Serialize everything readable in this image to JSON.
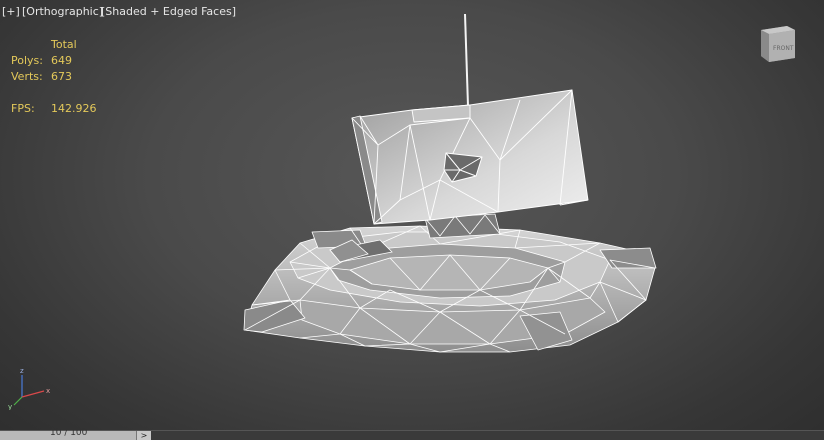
{
  "viewport": {
    "menu_plus": "[+]",
    "view_label": "[Orthographic]",
    "shading_label": "[Shaded + Edged Faces]"
  },
  "stats": {
    "header": "Total",
    "polys_label": "Polys:",
    "polys_value": "649",
    "verts_label": "Verts:",
    "verts_value": "673",
    "fps_label": "FPS:",
    "fps_value": "142.926"
  },
  "viewcube": {
    "face_label": "FRONT"
  },
  "axis": {
    "z": "z",
    "x": "x",
    "y": "y"
  },
  "timeline": {
    "frame_label": "10 / 100",
    "next_label": ">"
  },
  "colors": {
    "stats_text": "#e4c95a",
    "wire": "#ffffff",
    "mesh_fill": "#bdbdbd"
  }
}
